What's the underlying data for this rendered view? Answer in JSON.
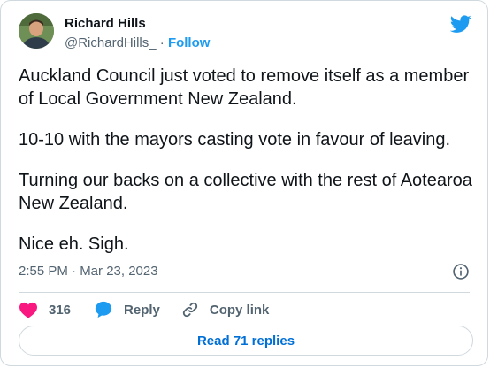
{
  "author": {
    "name": "Richard Hills",
    "handle": "@RichardHills_",
    "separator": "·",
    "follow_label": "Follow"
  },
  "tweet": {
    "paragraphs": [
      "Auckland Council just voted to remove itself as a member of Local Government New Zealand.",
      "10-10 with the mayors casting vote in favour of leaving.",
      "Turning our backs on a collective with the rest of Aotearoa New Zealand.",
      "Nice eh. Sigh."
    ],
    "timestamp": "2:55 PM · Mar 23, 2023"
  },
  "actions": {
    "like_count": "316",
    "reply_label": "Reply",
    "copy_link_label": "Copy link"
  },
  "read_replies_label": "Read 71 replies",
  "colors": {
    "heart": "#f91880",
    "reply": "#1d9bf0",
    "twitter_blue": "#1d9bf0",
    "link_blue": "#006fd6",
    "muted": "#536471"
  },
  "icons": [
    "twitter-bird-icon",
    "info-icon",
    "heart-icon",
    "reply-bubble-icon",
    "link-icon"
  ]
}
